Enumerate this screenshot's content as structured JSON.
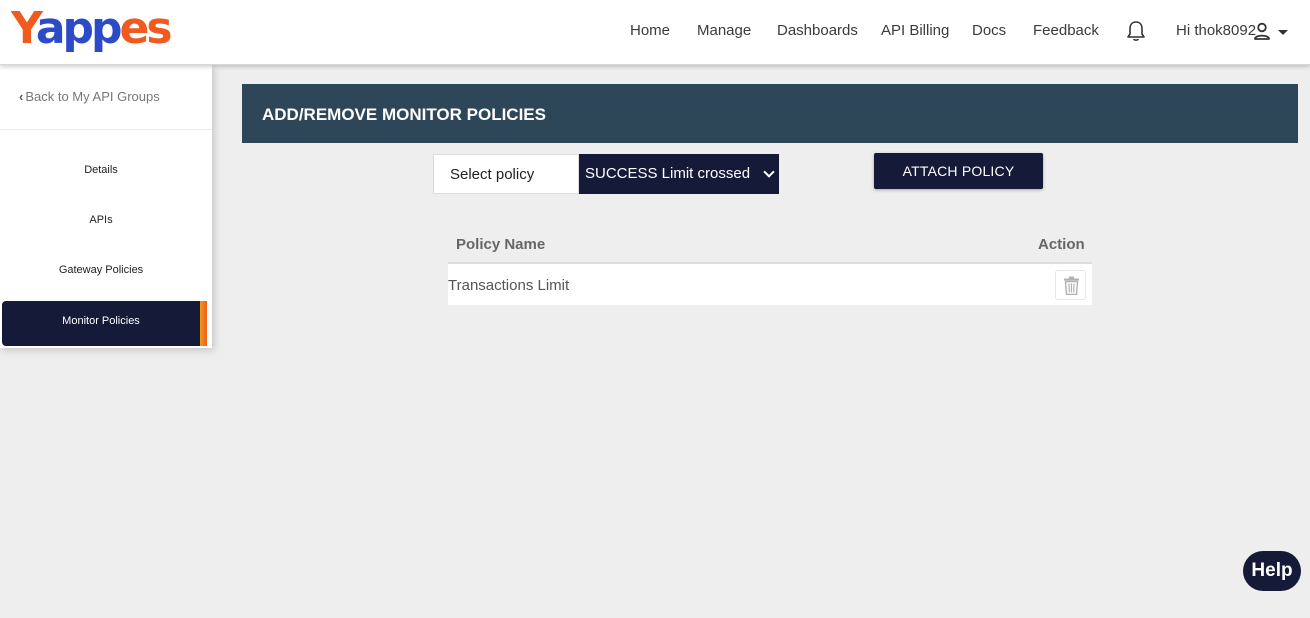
{
  "brand": {
    "logo_text_a": "Y",
    "logo_text_b": "a",
    "logo_text_c": "pp",
    "logo_text_d": "es",
    "orange": "#f05a1e",
    "blue": "#2c4bc9"
  },
  "nav": {
    "items": [
      {
        "label": "Home"
      },
      {
        "label": "Manage"
      },
      {
        "label": "Dashboards"
      },
      {
        "label": "API Billing"
      },
      {
        "label": "Docs"
      },
      {
        "label": "Feedback"
      }
    ],
    "bell_icon": "bell-icon",
    "user_greeting": "Hi thok8092",
    "user_icon": "person-icon"
  },
  "sidebar": {
    "back_label": "Back to My API Groups",
    "items": [
      {
        "label": "Details"
      },
      {
        "label": "APIs"
      },
      {
        "label": "Gateway Policies"
      },
      {
        "label": "Monitor Policies",
        "active": true
      }
    ]
  },
  "main": {
    "title": "ADD/REMOVE MONITOR POLICIES",
    "select_label": "Select policy",
    "select_value": "SUCCESS Limit crossed",
    "attach_label": "ATTACH POLICY",
    "table": {
      "headers": [
        "Policy Name",
        "Action"
      ],
      "rows": [
        {
          "name": "Transactions Limit",
          "action_icon": "trash-icon"
        }
      ]
    }
  },
  "help_label": "Help",
  "colors": {
    "navy": "#141a38",
    "panel_header": "#2d4759",
    "background": "#eeeeee"
  }
}
